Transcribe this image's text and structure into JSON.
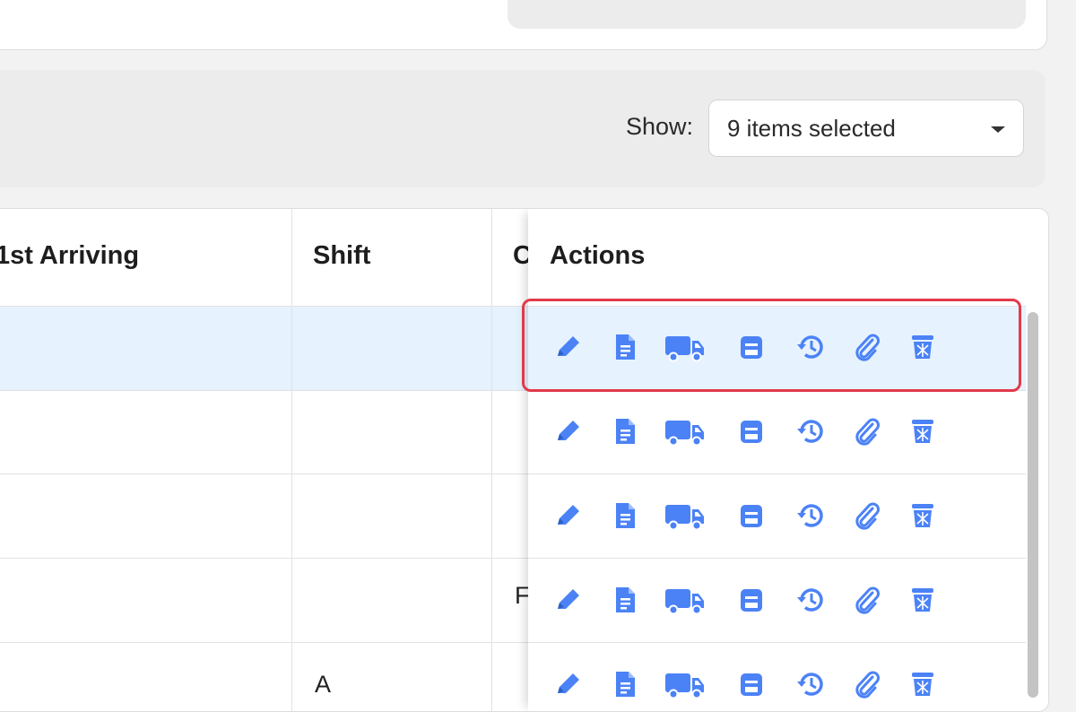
{
  "toolbar": {},
  "filter": {
    "show_label": "Show:",
    "show_value": "9 items selected"
  },
  "table": {
    "headers": {
      "first_arriving": "1st Arriving",
      "shift": "Shift",
      "partial_col": "C",
      "actions": "Actions"
    },
    "rows": [
      {
        "shift": "",
        "partial": "",
        "highlighted": true
      },
      {
        "shift": "",
        "partial": ""
      },
      {
        "shift": "",
        "partial": ""
      },
      {
        "shift": "",
        "partial": "F"
      },
      {
        "shift": "A",
        "partial": ""
      }
    ],
    "action_icons": [
      "edit-icon",
      "document-icon",
      "truck-icon",
      "print-icon",
      "history-icon",
      "attachment-icon",
      "delete-icon"
    ]
  },
  "colors": {
    "accent": "#4b82f6",
    "highlight_row": "#e6f2fd",
    "focus_outline": "#e2394a"
  }
}
